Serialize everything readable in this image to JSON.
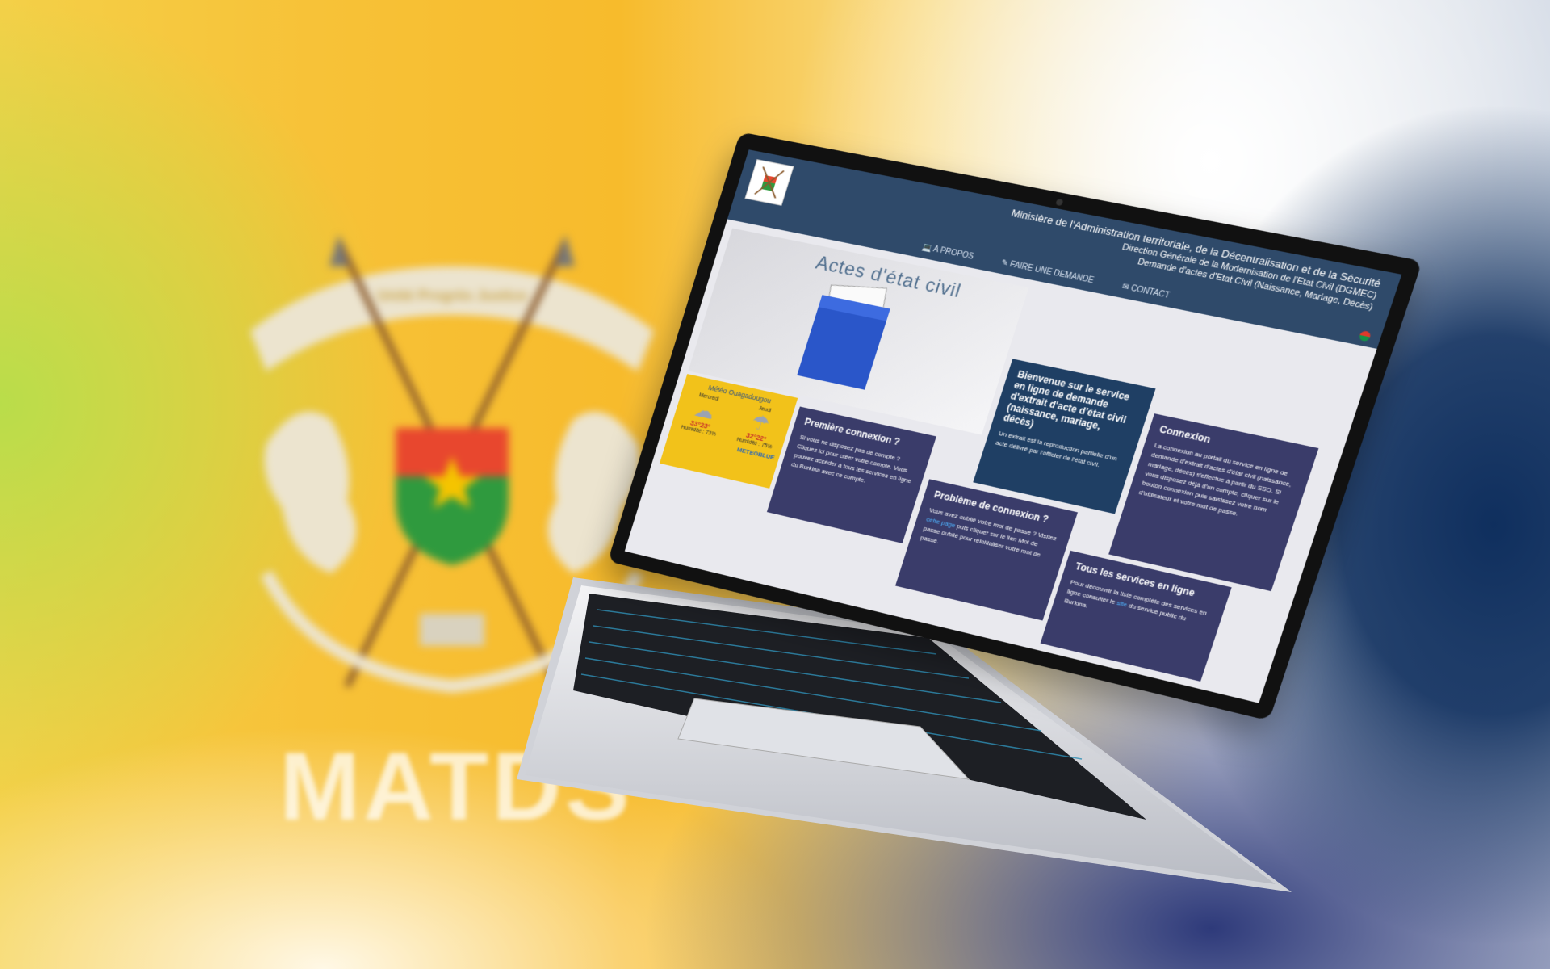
{
  "background": {
    "brand_text": "MATDS",
    "emblem": {
      "motto": "Unité Progrès Justice",
      "colors": {
        "red": "#e8472e",
        "green": "#2f9a3e",
        "star": "#f5c400",
        "cream": "#ece4cf"
      }
    }
  },
  "site": {
    "ministry_title": "Ministère de l'Administration territoriale, de la Décentralisation et de la Sécurité",
    "directorate": "Direction Générale de la Modernisation de l'Etat Civil (DGMEC)",
    "service_title": "Demande d'actes d'Etat Civil (Naissance, Mariage, Décès)",
    "nav": [
      {
        "label": "A propos",
        "icon": "laptop-icon"
      },
      {
        "label": "Faire une demande",
        "icon": "edit-icon"
      },
      {
        "label": "Contact",
        "icon": "envelope-icon"
      }
    ],
    "hero_title": "Actes d'état civil",
    "weather": {
      "title": "Météo Ouagadougou",
      "days": [
        {
          "day": "Mercredi",
          "temp": "33°23°",
          "humidity": "Humidité : 73%",
          "icon": "cloud-sun-icon"
        },
        {
          "day": "Jeudi",
          "temp": "32°22°",
          "humidity": "Humidité : 75%",
          "icon": "cloud-rain-icon"
        }
      ],
      "brand": "METEOBLUE"
    },
    "cards": {
      "welcome": {
        "title": "Bienvenue sur le service en ligne de demande d'extrait d'acte d'état civil (naissance, mariage, décès)",
        "body": "Un extrait est la reproduction partielle d'un acte délivré par l'officier de l'état civil."
      },
      "connexion": {
        "title": "Connexion",
        "body": "La connexion au portail du service en ligne de demande d'extrait d'actes d'état civil (naissance, mariage, décès) s'effectue à partir du SSO. Si vous disposez déjà d'un compte, cliquer sur le bouton connexion puis saisissez votre nom d'utilisateur et votre mot de passe."
      },
      "premiere": {
        "title": "Première connexion ?",
        "body": "Si vous ne disposez pas de compte ? Cliquez ici pour créer votre compte. Vous pouvez accéder à tous les services en ligne du Burkina avec ce compte."
      },
      "probleme": {
        "title": "Problème de connexion ?",
        "body_start": "Vous avez oublié votre mot de passe ? Visitez ",
        "link": "cette page",
        "body_end": " puis cliquer sur le lien Mot de passe oublié pour réinitialiser votre mot de passe."
      },
      "services": {
        "title": "Tous les services en ligne",
        "body_start": "Pour découvrir la liste complète des services en ligne consulter le ",
        "link": "site",
        "body_end": " du service public du Burkina."
      }
    },
    "colors": {
      "header": "#2f4a6a",
      "card_blue": "#1f3f64",
      "card_purple": "#3a3c6a",
      "weather": "#f2c21a"
    }
  }
}
